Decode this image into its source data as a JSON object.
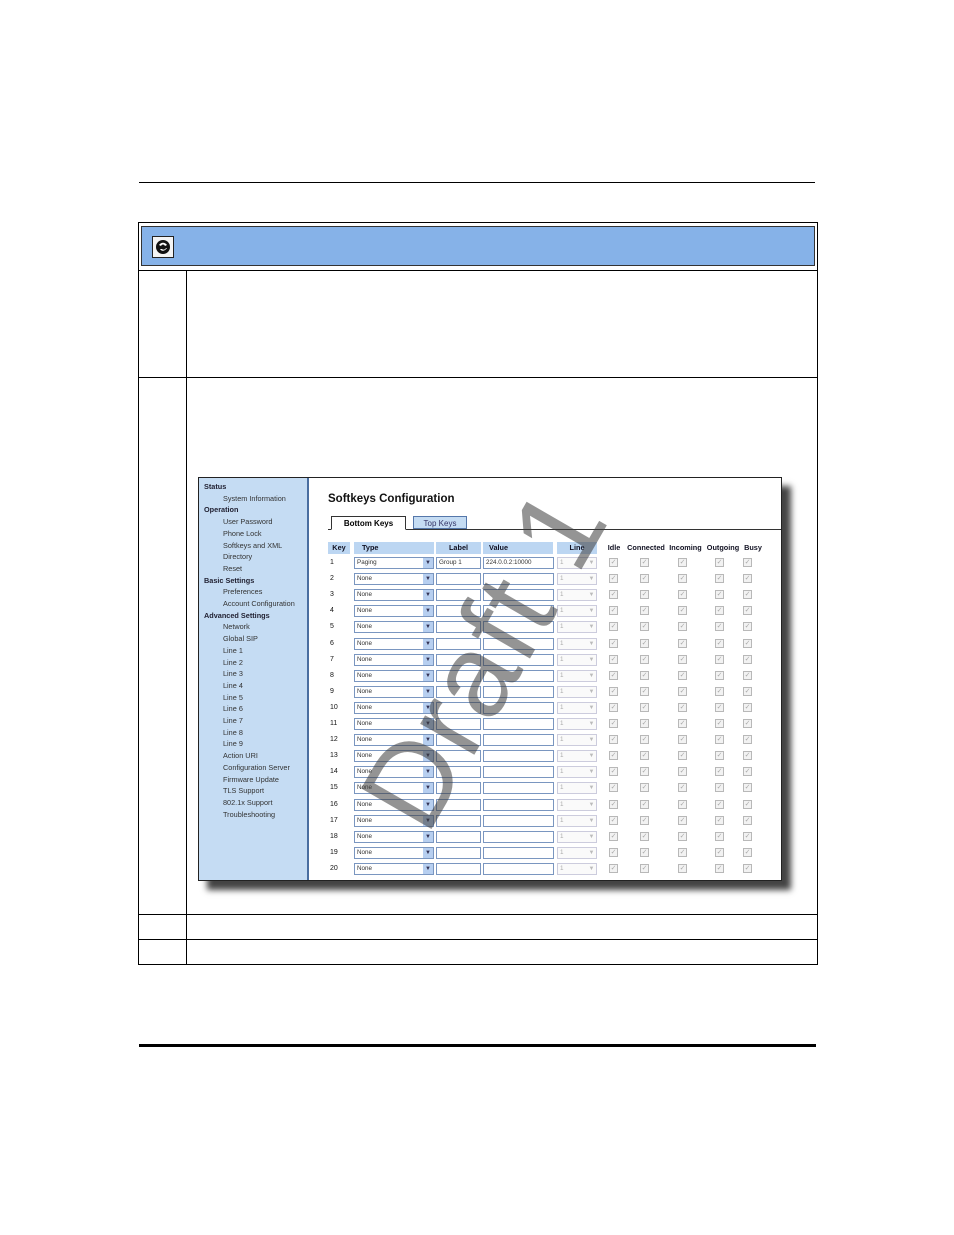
{
  "header": {
    "icon": "globe-phone-icon"
  },
  "watermark": "Draft 1",
  "ui": {
    "sidebar": [
      {
        "type": "section",
        "label": "Status"
      },
      {
        "type": "item",
        "label": "System Information"
      },
      {
        "type": "section",
        "label": "Operation"
      },
      {
        "type": "item",
        "label": "User Password"
      },
      {
        "type": "item",
        "label": "Phone Lock"
      },
      {
        "type": "item",
        "label": "Softkeys and XML"
      },
      {
        "type": "item",
        "label": "Directory"
      },
      {
        "type": "item",
        "label": "Reset"
      },
      {
        "type": "section",
        "label": "Basic Settings"
      },
      {
        "type": "item",
        "label": "Preferences"
      },
      {
        "type": "item",
        "label": "Account Configuration"
      },
      {
        "type": "section",
        "label": "Advanced Settings"
      },
      {
        "type": "item",
        "label": "Network"
      },
      {
        "type": "item",
        "label": "Global SIP"
      },
      {
        "type": "item",
        "label": "Line 1"
      },
      {
        "type": "item",
        "label": "Line 2"
      },
      {
        "type": "item",
        "label": "Line 3"
      },
      {
        "type": "item",
        "label": "Line 4"
      },
      {
        "type": "item",
        "label": "Line 5"
      },
      {
        "type": "item",
        "label": "Line 6"
      },
      {
        "type": "item",
        "label": "Line 7"
      },
      {
        "type": "item",
        "label": "Line 8"
      },
      {
        "type": "item",
        "label": "Line 9"
      },
      {
        "type": "item",
        "label": "Action URI"
      },
      {
        "type": "item",
        "label": "Configuration Server"
      },
      {
        "type": "item",
        "label": "Firmware Update"
      },
      {
        "type": "item",
        "label": "TLS Support"
      },
      {
        "type": "item",
        "label": "802.1x Support"
      },
      {
        "type": "item",
        "label": "Troubleshooting"
      }
    ],
    "title": "Softkeys Configuration",
    "tabs": {
      "bottom": "Bottom Keys",
      "top": "Top Keys"
    },
    "columns": {
      "key": "Key",
      "type": "Type",
      "label": "Label",
      "value": "Value",
      "line": "Line",
      "idle": "Idle",
      "connected": "Connected",
      "incoming": "Incoming",
      "outgoing": "Outgoing",
      "busy": "Busy"
    },
    "rows": [
      {
        "key": "1",
        "type": "Paging",
        "label": "Group 1",
        "value": "224.0.0.2:10000",
        "line": "1"
      },
      {
        "key": "2",
        "type": "None",
        "label": "",
        "value": "",
        "line": "1"
      },
      {
        "key": "3",
        "type": "None",
        "label": "",
        "value": "",
        "line": "1"
      },
      {
        "key": "4",
        "type": "None",
        "label": "",
        "value": "",
        "line": "1"
      },
      {
        "key": "5",
        "type": "None",
        "label": "",
        "value": "",
        "line": "1"
      },
      {
        "key": "6",
        "type": "None",
        "label": "",
        "value": "",
        "line": "1"
      },
      {
        "key": "7",
        "type": "None",
        "label": "",
        "value": "",
        "line": "1"
      },
      {
        "key": "8",
        "type": "None",
        "label": "",
        "value": "",
        "line": "1"
      },
      {
        "key": "9",
        "type": "None",
        "label": "",
        "value": "",
        "line": "1"
      },
      {
        "key": "10",
        "type": "None",
        "label": "",
        "value": "",
        "line": "1"
      },
      {
        "key": "11",
        "type": "None",
        "label": "",
        "value": "",
        "line": "1"
      },
      {
        "key": "12",
        "type": "None",
        "label": "",
        "value": "",
        "line": "1"
      },
      {
        "key": "13",
        "type": "None",
        "label": "",
        "value": "",
        "line": "1"
      },
      {
        "key": "14",
        "type": "None",
        "label": "",
        "value": "",
        "line": "1"
      },
      {
        "key": "15",
        "type": "None",
        "label": "",
        "value": "",
        "line": "1"
      },
      {
        "key": "16",
        "type": "None",
        "label": "",
        "value": "",
        "line": "1"
      },
      {
        "key": "17",
        "type": "None",
        "label": "",
        "value": "",
        "line": "1"
      },
      {
        "key": "18",
        "type": "None",
        "label": "",
        "value": "",
        "line": "1"
      },
      {
        "key": "19",
        "type": "None",
        "label": "",
        "value": "",
        "line": "1"
      },
      {
        "key": "20",
        "type": "None",
        "label": "",
        "value": "",
        "line": "1"
      }
    ]
  }
}
